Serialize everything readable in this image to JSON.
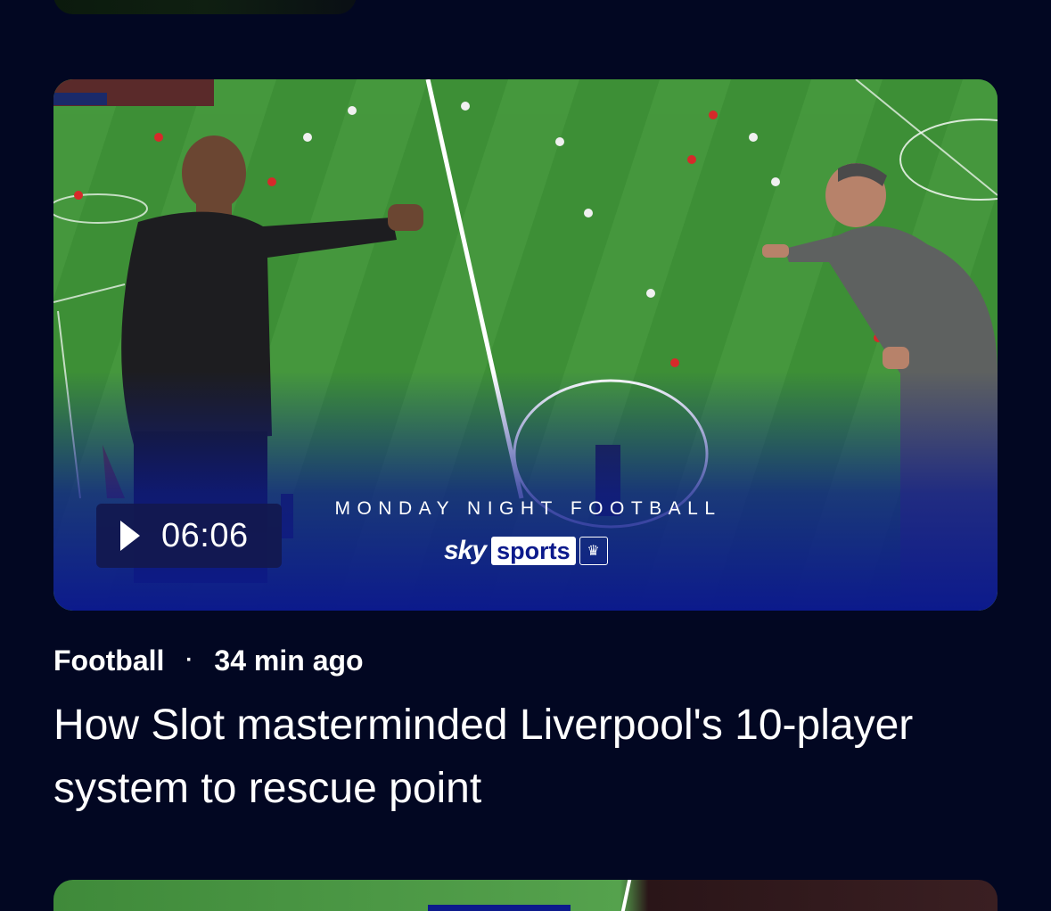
{
  "cards": {
    "main": {
      "video": {
        "duration": "06:06",
        "play_icon": "play-icon",
        "show_title": "MONDAY NIGHT FOOTBALL",
        "brand_primary": "sky",
        "brand_secondary": "sports",
        "league_logo_icon": "premier-league-lion-icon"
      },
      "category": "Football",
      "separator": "·",
      "timestamp": "34 min ago",
      "headline": "How Slot masterminded Liverpool's 10-player system to rescue point"
    }
  },
  "colors": {
    "background": "#020722",
    "overlay_blue": "#0c1a8c",
    "text": "#ffffff"
  }
}
